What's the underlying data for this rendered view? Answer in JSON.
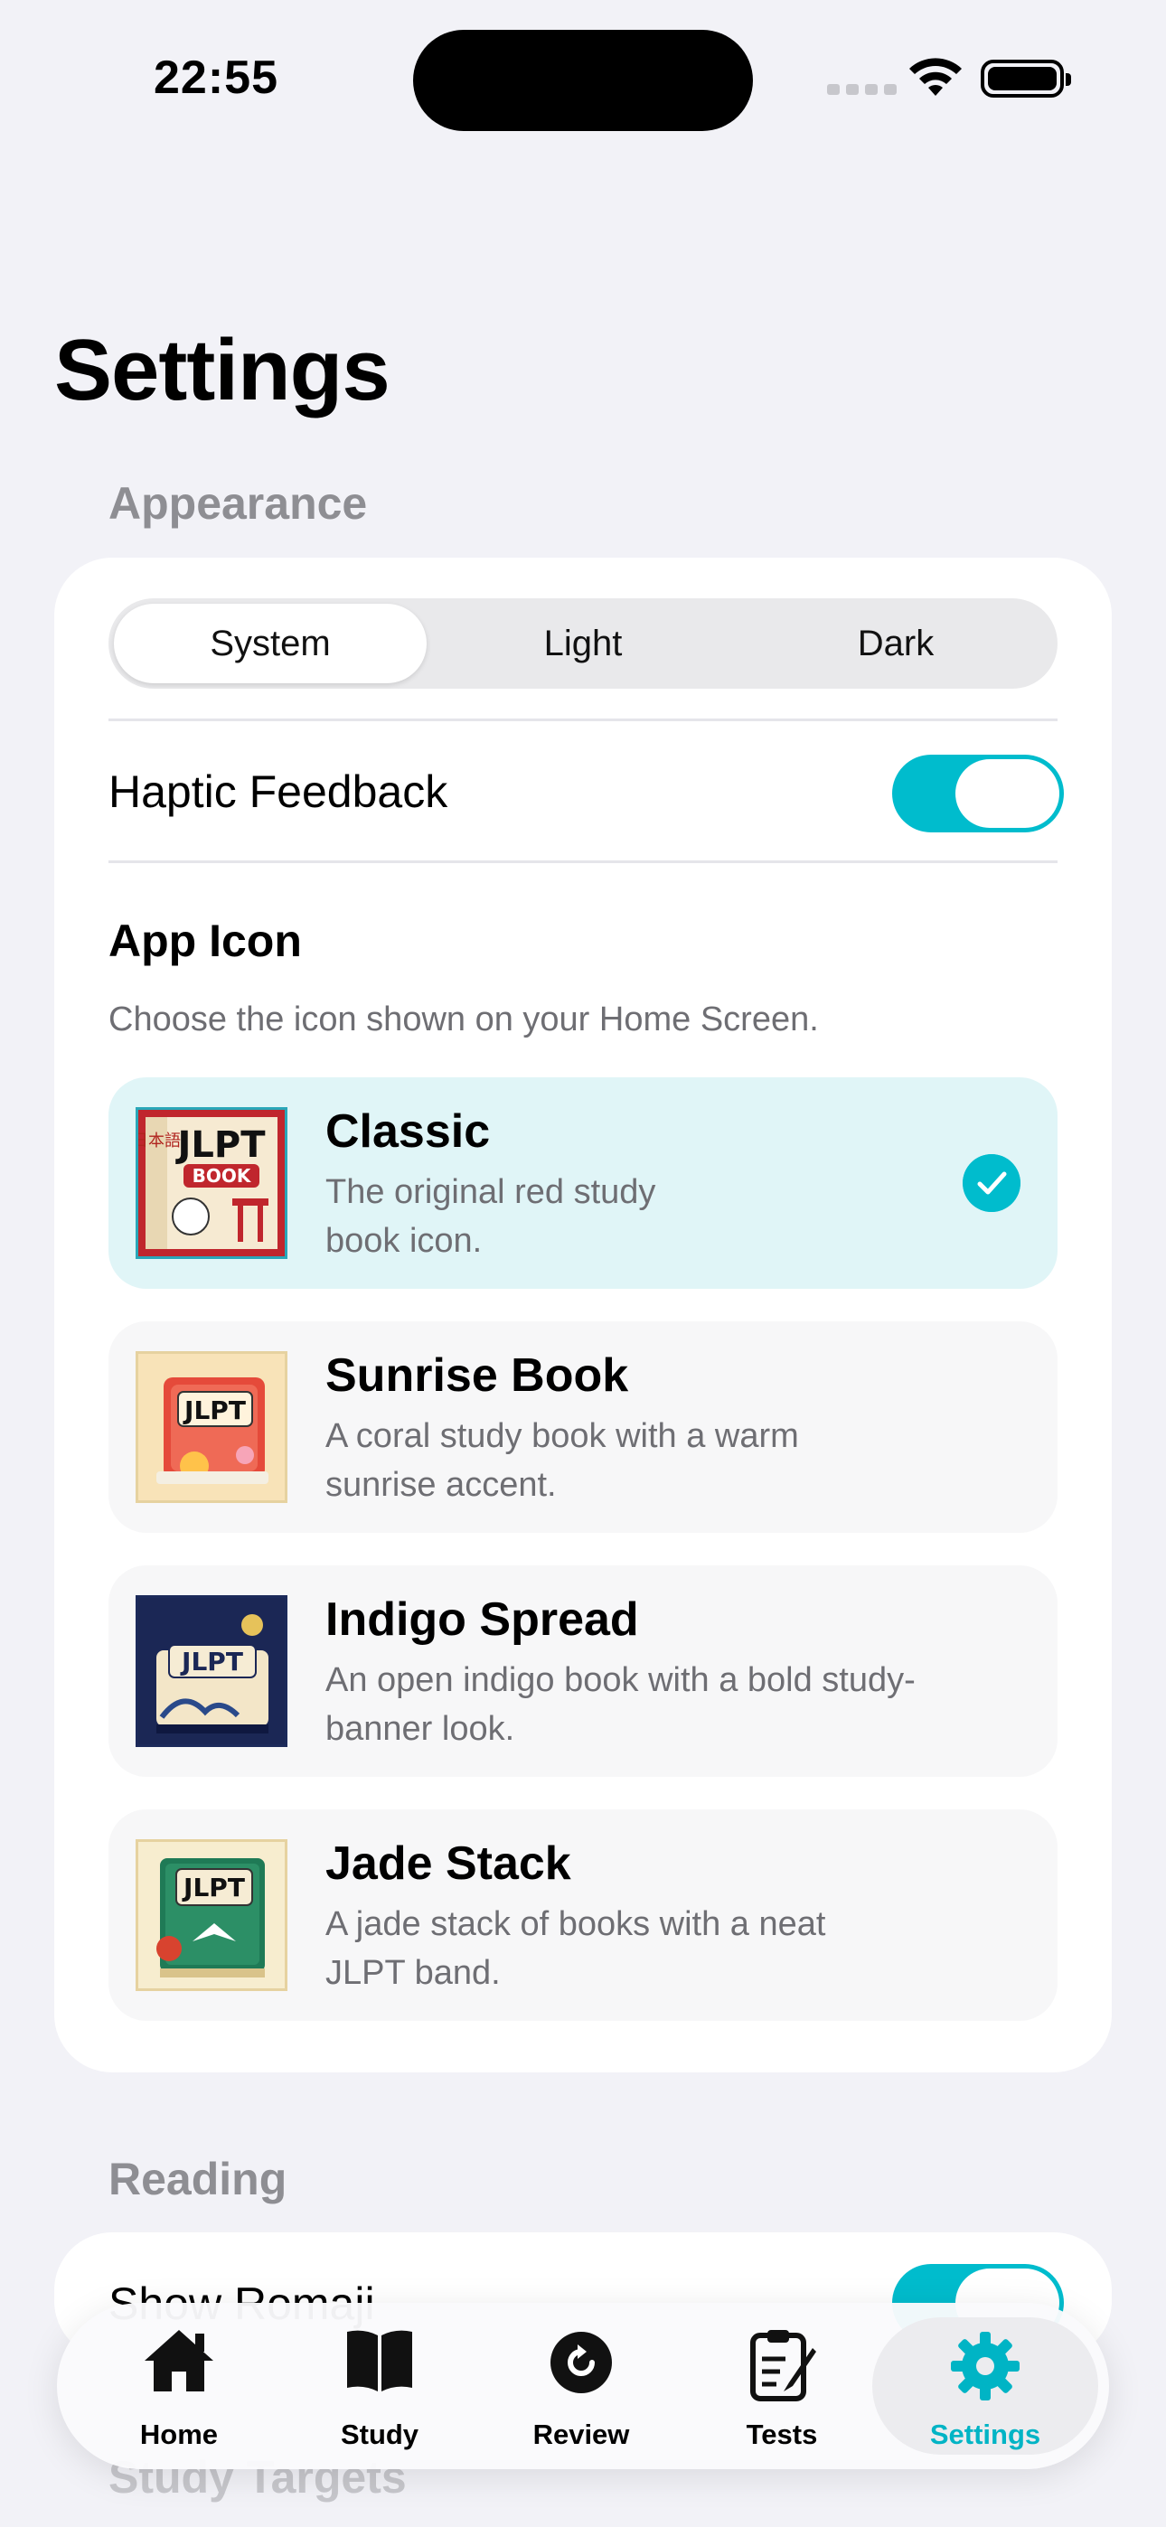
{
  "status_bar": {
    "time": "22:55"
  },
  "page": {
    "title": "Settings"
  },
  "appearance": {
    "header": "Appearance",
    "theme_options": [
      "System",
      "Light",
      "Dark"
    ],
    "selected_theme": "System",
    "haptic_label": "Haptic Feedback",
    "haptic_on": true
  },
  "app_icon": {
    "title": "App Icon",
    "subtitle": "Choose the icon shown on your Home Screen.",
    "selected": "Classic",
    "options": [
      {
        "name": "Classic",
        "desc1": "The original red study",
        "desc2": "book icon."
      },
      {
        "name": "Sunrise Book",
        "desc1": "A coral study book with a warm",
        "desc2": "sunrise accent."
      },
      {
        "name": "Indigo Spread",
        "desc1": "An open indigo book with a bold study-",
        "desc2": "banner look."
      },
      {
        "name": "Jade Stack",
        "desc1": "A jade stack of books with a neat",
        "desc2": "JLPT band."
      }
    ],
    "icon_art_text": {
      "jlpt": "JLPT",
      "book": "BOOK",
      "nihongo": "日本語"
    }
  },
  "reading": {
    "header": "Reading",
    "show_romaji_label": "Show Romaji",
    "show_romaji_on": true
  },
  "study_targets": {
    "header": "Study Targets"
  },
  "tab_bar": {
    "tabs": [
      {
        "label": "Home",
        "icon": "house-icon"
      },
      {
        "label": "Study",
        "icon": "book-icon"
      },
      {
        "label": "Review",
        "icon": "review-icon"
      },
      {
        "label": "Tests",
        "icon": "clipboard-icon"
      },
      {
        "label": "Settings",
        "icon": "gear-icon"
      }
    ],
    "active": "Settings"
  },
  "colors": {
    "accent": "#00bccd",
    "background": "#f2f2f7",
    "selected_row": "#e0f5f7"
  }
}
